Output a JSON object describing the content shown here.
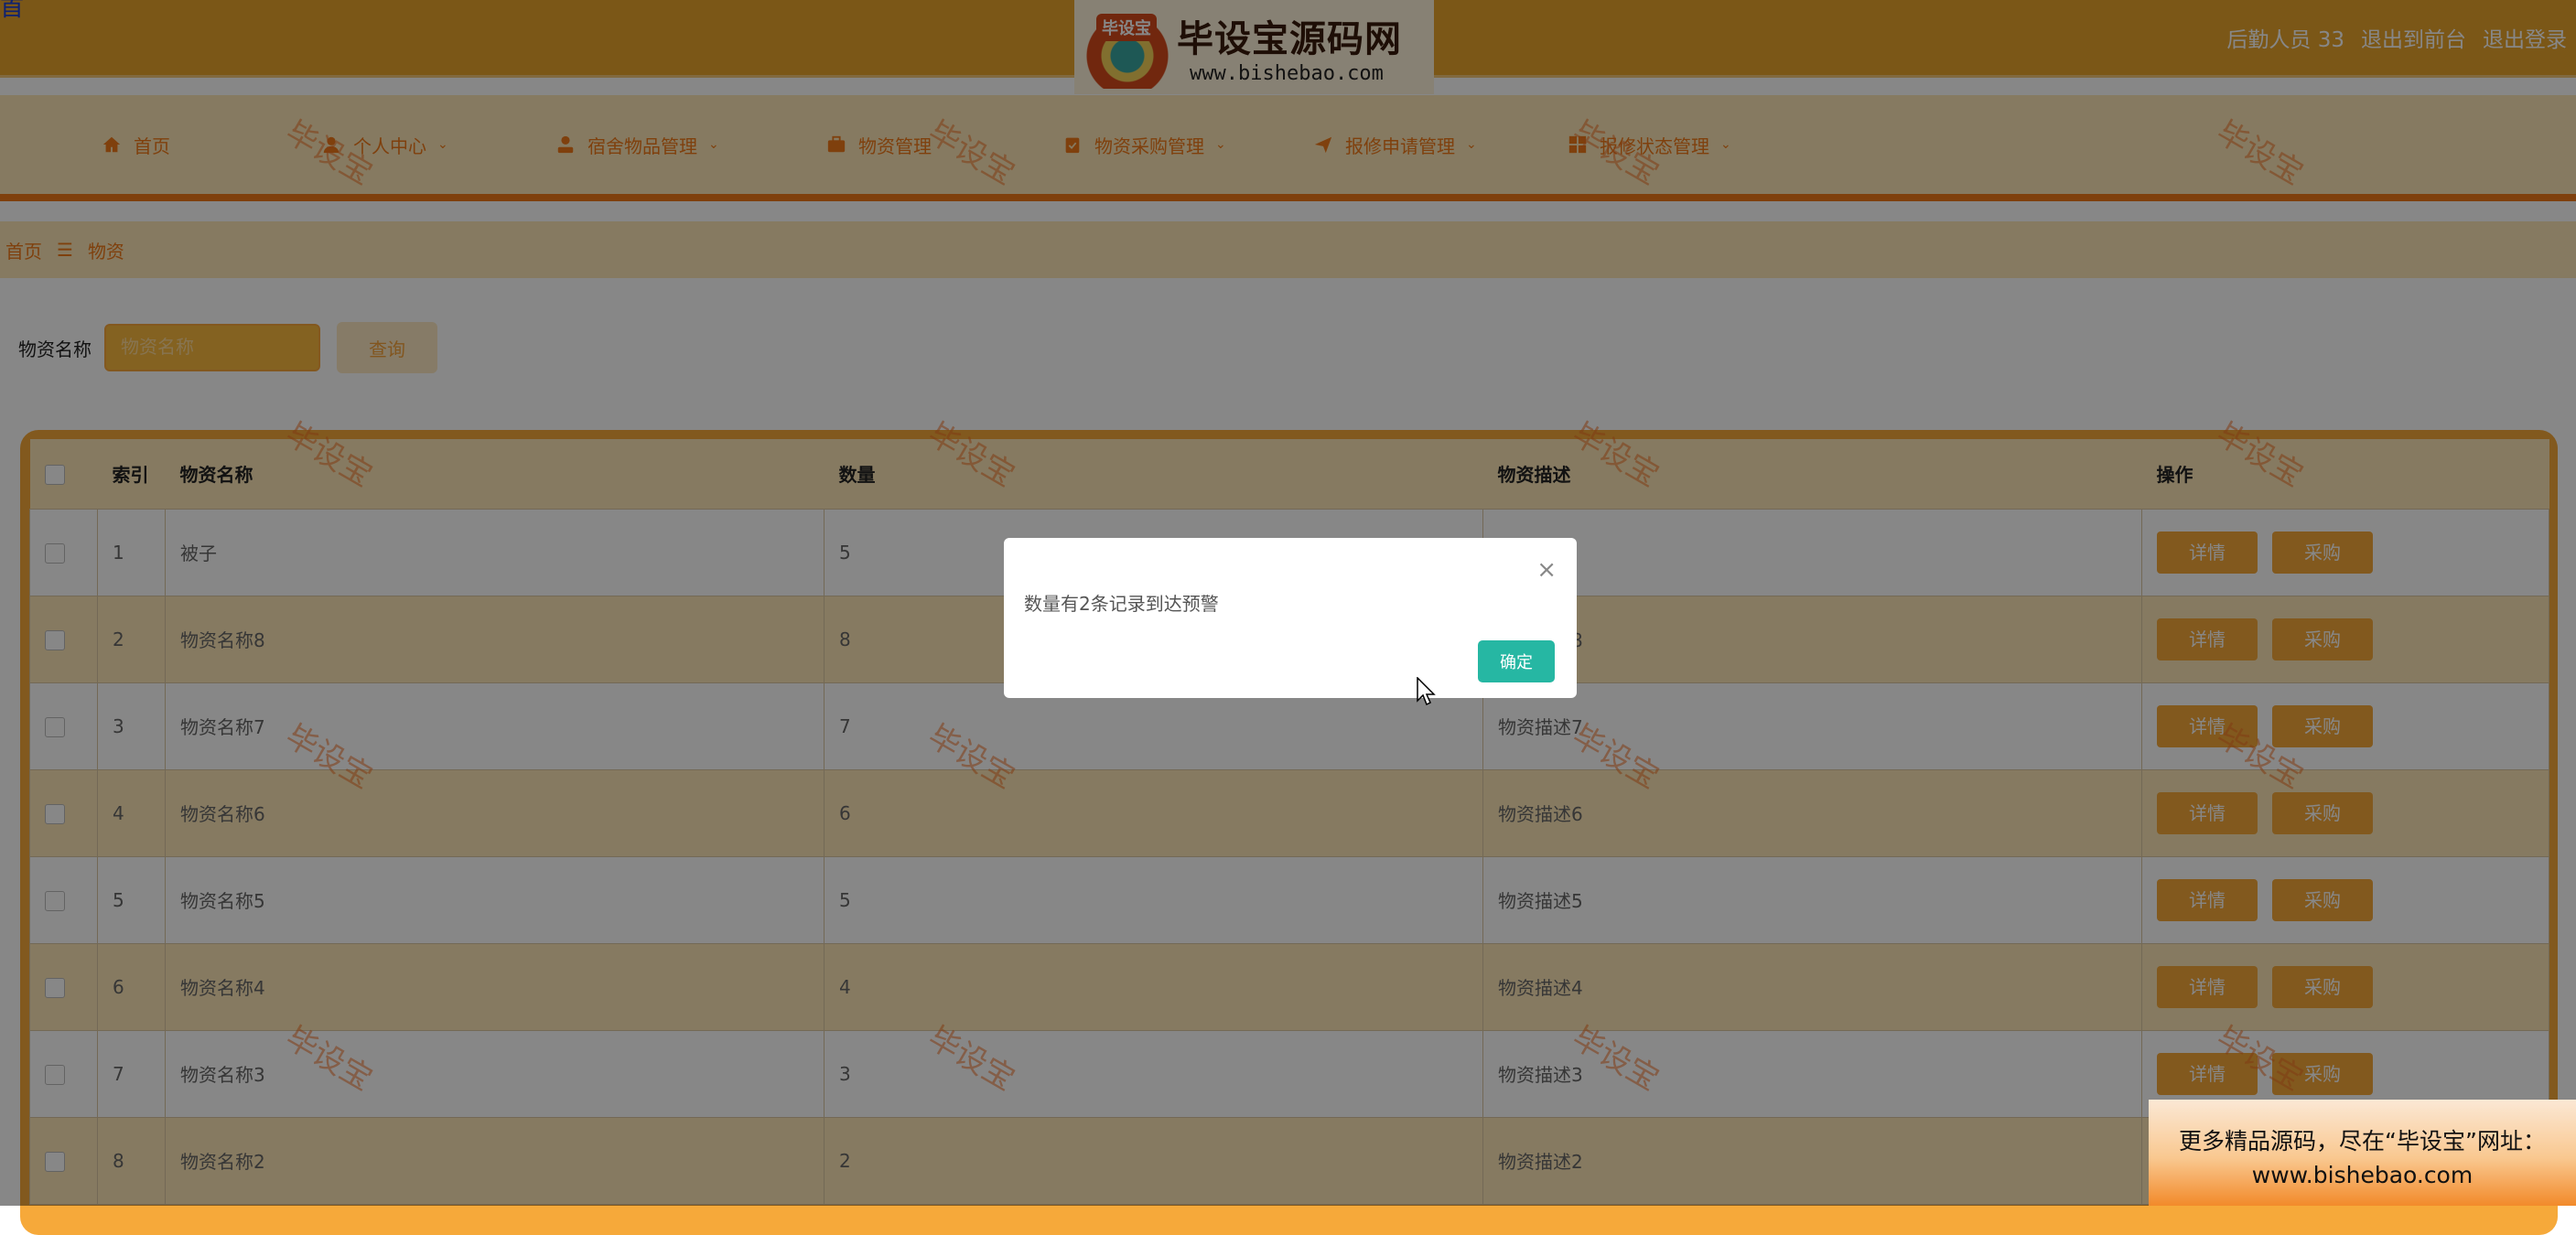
{
  "header": {
    "title_clip": "首",
    "logo_text": "毕设宝源码网",
    "logo_badge": "毕设宝",
    "logo_url": "www.bishebao.com",
    "user": "后勤人员 33",
    "back_front": "退出到前台",
    "logout": "退出登录"
  },
  "nav": {
    "items": [
      {
        "label": "首页",
        "icon": "home-icon"
      },
      {
        "label": "个人中心",
        "icon": "user-icon"
      },
      {
        "label": "宿舍物品管理",
        "icon": "person-icon"
      },
      {
        "label": "物资管理",
        "icon": "briefcase-icon"
      },
      {
        "label": "物资采购管理",
        "icon": "clipboard-icon"
      },
      {
        "label": "报修申请管理",
        "icon": "send-icon"
      },
      {
        "label": "报修状态管理",
        "icon": "grid-icon"
      }
    ]
  },
  "breadcrumb": {
    "home": "首页",
    "sep": "☰",
    "current": "物资"
  },
  "search": {
    "label": "物资名称",
    "placeholder": "物资名称",
    "button": "查询"
  },
  "table": {
    "headers": [
      "索引",
      "物资名称",
      "数量",
      "物资描述",
      "操作"
    ],
    "detail_label": "详情",
    "buy_label": "采购",
    "rows": [
      {
        "index": "1",
        "name": "被子",
        "qty": "5",
        "desc": ""
      },
      {
        "index": "2",
        "name": "物资名称8",
        "qty": "8",
        "desc": "物资描述8"
      },
      {
        "index": "3",
        "name": "物资名称7",
        "qty": "7",
        "desc": "物资描述7"
      },
      {
        "index": "4",
        "name": "物资名称6",
        "qty": "6",
        "desc": "物资描述6"
      },
      {
        "index": "5",
        "name": "物资名称5",
        "qty": "5",
        "desc": "物资描述5"
      },
      {
        "index": "6",
        "name": "物资名称4",
        "qty": "4",
        "desc": "物资描述4"
      },
      {
        "index": "7",
        "name": "物资名称3",
        "qty": "3",
        "desc": "物资描述3"
      },
      {
        "index": "8",
        "name": "物资名称2",
        "qty": "2",
        "desc": "物资描述2"
      }
    ]
  },
  "dialog": {
    "message": "数量有2条记录到达预警",
    "ok": "确定",
    "close": "×"
  },
  "watermark": "毕设宝",
  "ad": {
    "line1": "更多精品源码，尽在“毕设宝”网址：",
    "line2": "www.bishebao.com"
  },
  "colors": {
    "primary": "#f6a93a",
    "accent": "#f07a1a",
    "confirm": "#26b7a3"
  }
}
